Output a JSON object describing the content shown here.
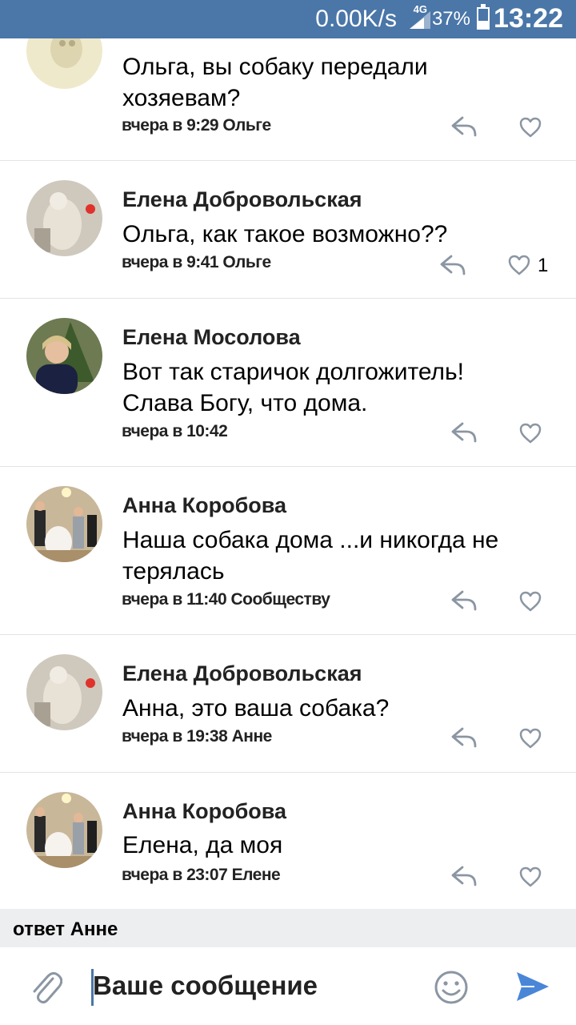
{
  "status_bar": {
    "net_speed": "0.00K/s",
    "network": "4G",
    "battery_percent": "37%",
    "battery_level": 0.37,
    "time": "13:22"
  },
  "comments": [
    {
      "author": "",
      "text": "Ольга, вы собаку передали хозяевам?",
      "meta": "вчера в 9:29 Ольге",
      "likes": ""
    },
    {
      "author": "Елена Добровольская",
      "text": "Ольга, как такое возможно??",
      "meta": "вчера в 9:41 Ольге",
      "likes": "1"
    },
    {
      "author": "Елена Мосолова",
      "text": "Вот так старичок долгожитель! Слава Богу, что дома.",
      "meta": "вчера в 10:42",
      "likes": ""
    },
    {
      "author": "Анна Коробова",
      "text": "Наша собака дома ...и никогда не терялась",
      "meta": "вчера в 11:40 Сообществу",
      "likes": ""
    },
    {
      "author": "Елена Добровольская",
      "text": "Анна, это ваша собака?",
      "meta": "вчера в 19:38 Анне",
      "likes": ""
    },
    {
      "author": "Анна Коробова",
      "text": "Елена, да моя",
      "meta": "вчера в 23:07 Елене",
      "likes": ""
    }
  ],
  "reply_to": "ответ Анне",
  "composer": {
    "placeholder": "Ваше сообщение"
  },
  "colors": {
    "accent": "#4a76a8",
    "divider": "#e1e3e6",
    "icon_gray": "#8b96a3",
    "send_blue": "#4a86d8"
  }
}
